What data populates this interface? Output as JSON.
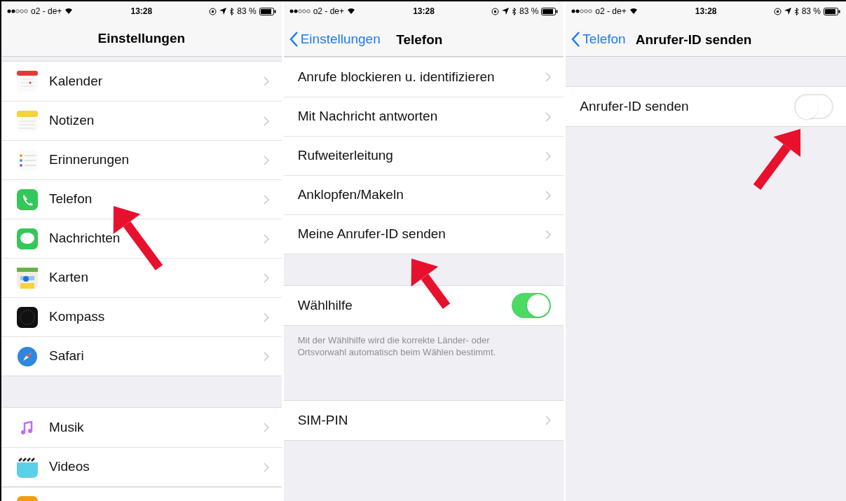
{
  "panels": [
    {
      "status_bar": {
        "carrier": "o2 - de+",
        "time": "13:28",
        "battery": "83 %"
      },
      "nav": {
        "title": "Einstellungen"
      },
      "groups": [
        {
          "items": [
            {
              "kind": "link",
              "label": "Kalender"
            },
            {
              "kind": "link",
              "label": "Notizen"
            },
            {
              "kind": "link",
              "label": "Erinnerungen"
            },
            {
              "kind": "link",
              "label": "Telefon"
            },
            {
              "kind": "link",
              "label": "Nachrichten"
            },
            {
              "kind": "link",
              "label": "Karten"
            },
            {
              "kind": "link",
              "label": "Kompass"
            },
            {
              "kind": "link",
              "label": "Safari"
            }
          ]
        },
        {
          "items": [
            {
              "kind": "link",
              "label": "Musik"
            },
            {
              "kind": "link",
              "label": "Videos"
            }
          ]
        }
      ]
    },
    {
      "status_bar": {
        "carrier": "o2 - de+",
        "time": "13:28",
        "battery": "83 %"
      },
      "nav": {
        "back": "Einstellungen",
        "title": "Telefon"
      },
      "groups": [
        {
          "items": [
            {
              "kind": "link",
              "label": "Anrufe blockieren u. identifizieren"
            },
            {
              "kind": "link",
              "label": "Mit Nachricht antworten"
            },
            {
              "kind": "link",
              "label": "Rufweiterleitung"
            },
            {
              "kind": "link",
              "label": "Anklopfen/Makeln"
            },
            {
              "kind": "link",
              "label": "Meine Anrufer-ID senden"
            }
          ]
        },
        {
          "items": [
            {
              "kind": "toggle",
              "label": "Wählhilfe",
              "on": true
            }
          ],
          "footer": "Mit der Wählhilfe wird die korrekte Länder- oder Ortsvorwahl automatisch beim Wählen bestimmt."
        },
        {
          "items": [
            {
              "kind": "link",
              "label": "SIM-PIN"
            }
          ]
        }
      ]
    },
    {
      "status_bar": {
        "carrier": "o2 - de+",
        "time": "13:28",
        "battery": "83 %"
      },
      "nav": {
        "back": "Telefon",
        "title": "Anrufer-ID senden"
      },
      "groups": [
        {
          "items": [
            {
              "kind": "toggle",
              "label": "Anrufer-ID senden",
              "on": false
            }
          ]
        }
      ]
    }
  ]
}
